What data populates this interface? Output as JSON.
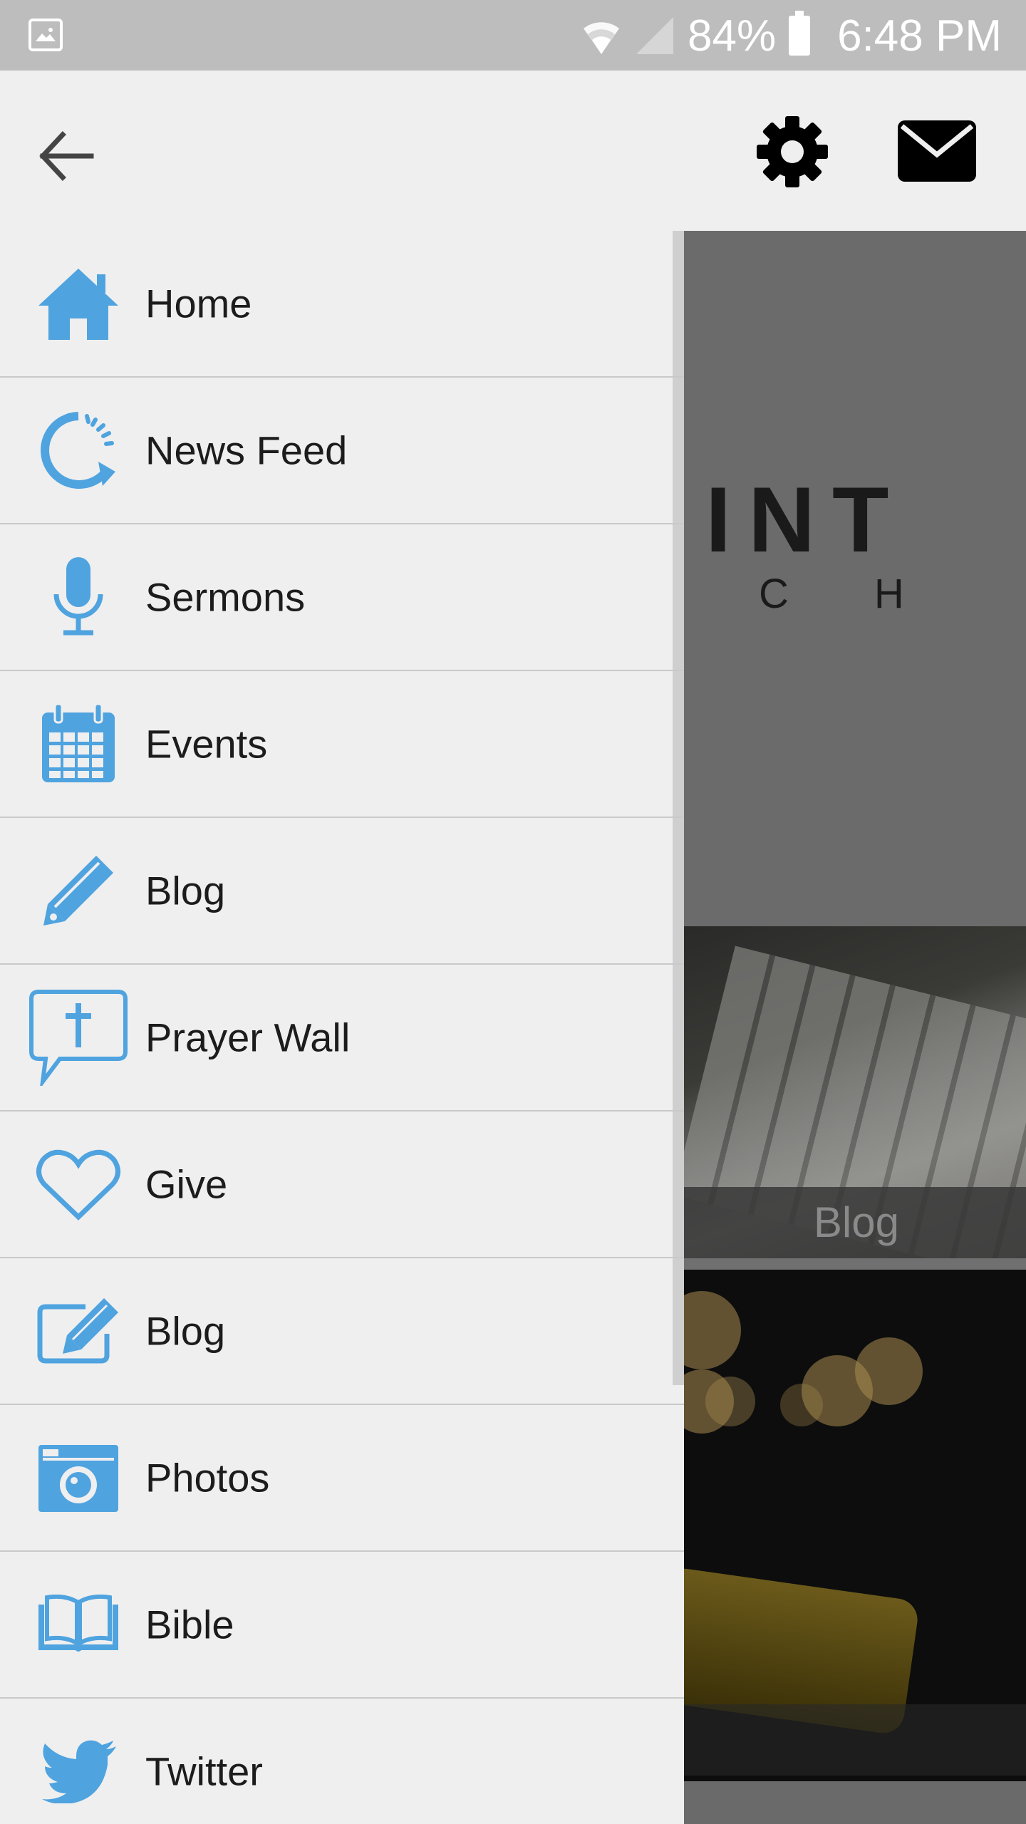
{
  "status_bar": {
    "battery": "84%",
    "time": "6:48 PM",
    "icons": [
      "image-icon",
      "wifi-icon",
      "signal-icon",
      "battery-icon"
    ]
  },
  "header": {
    "icons": [
      "back-arrow-icon",
      "gear-icon",
      "mail-icon"
    ]
  },
  "menu": {
    "accent_color": "#4fa3df",
    "items": [
      {
        "label": "Home",
        "icon": "home-icon"
      },
      {
        "label": "News Feed",
        "icon": "refresh-icon"
      },
      {
        "label": "Sermons",
        "icon": "microphone-icon"
      },
      {
        "label": "Events",
        "icon": "calendar-icon"
      },
      {
        "label": "Blog",
        "icon": "pencil-icon"
      },
      {
        "label": "Prayer Wall",
        "icon": "prayer-bubble-icon"
      },
      {
        "label": "Give",
        "icon": "heart-icon"
      },
      {
        "label": "Blog",
        "icon": "edit-icon"
      },
      {
        "label": "Photos",
        "icon": "camera-icon"
      },
      {
        "label": "Bible",
        "icon": "book-icon"
      },
      {
        "label": "Twitter",
        "icon": "twitter-icon"
      }
    ]
  },
  "background": {
    "logo_text": "INT",
    "logo_sub": "CH",
    "tile_label": "Blog"
  }
}
